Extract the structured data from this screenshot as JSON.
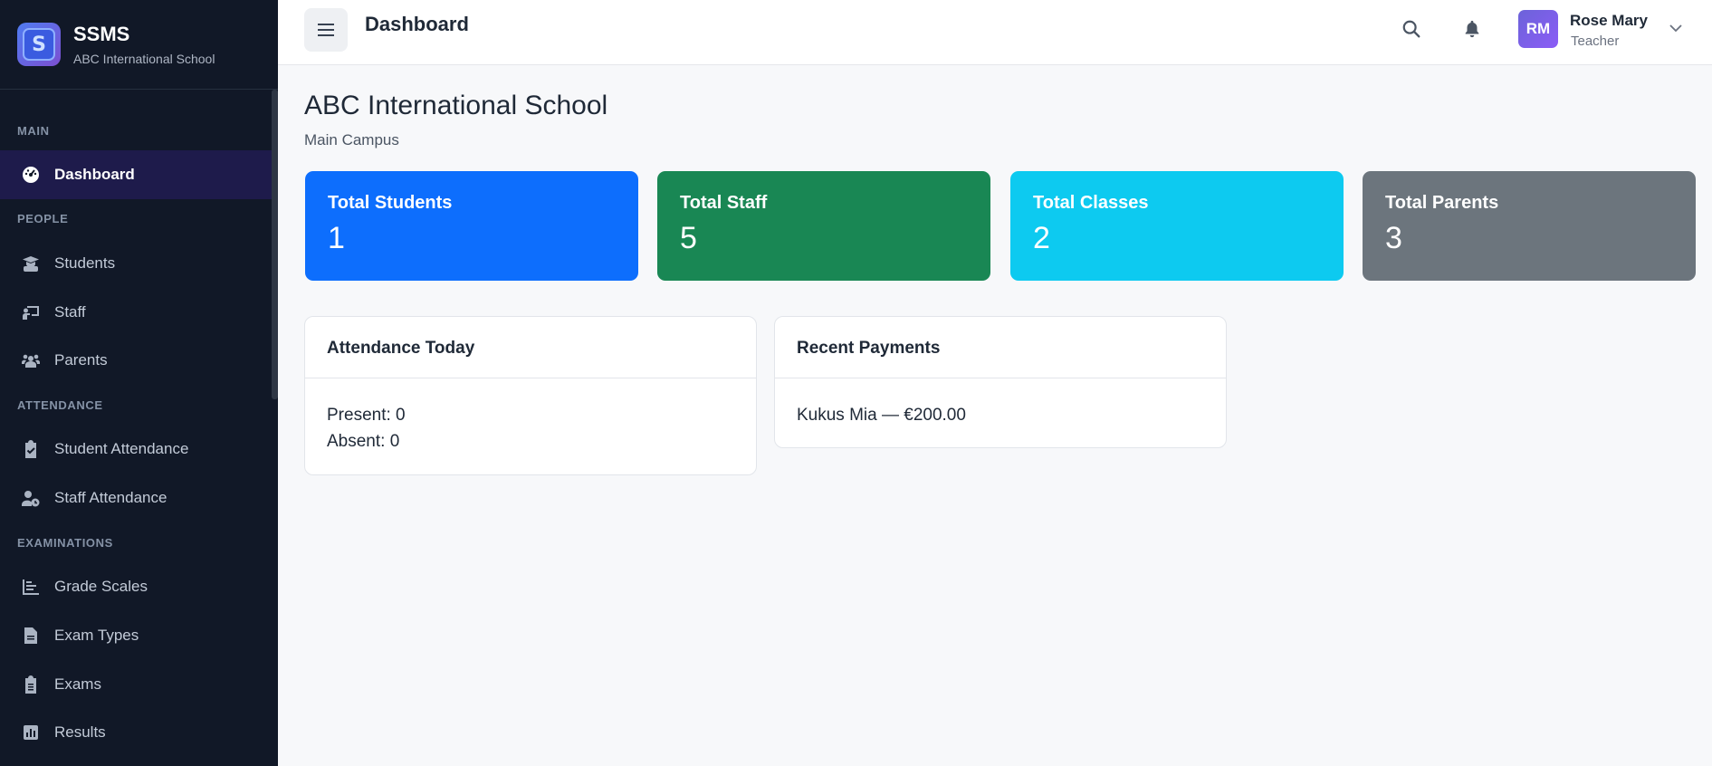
{
  "brand": {
    "name": "SSMS",
    "subtitle": "ABC International School"
  },
  "sidebar": {
    "sections": {
      "main": "MAIN",
      "people": "PEOPLE",
      "attendance": "ATTENDANCE",
      "examinations": "EXAMINATIONS"
    },
    "items": [
      {
        "label": "Dashboard",
        "icon": "dashboard-icon",
        "active": true
      },
      {
        "label": "Students",
        "icon": "graduate-icon"
      },
      {
        "label": "Staff",
        "icon": "chalkboard-teacher-icon"
      },
      {
        "label": "Parents",
        "icon": "users-icon"
      },
      {
        "label": "Student Attendance",
        "icon": "clipboard-check-icon"
      },
      {
        "label": "Staff Attendance",
        "icon": "user-clock-icon"
      },
      {
        "label": "Grade Scales",
        "icon": "chart-bars-icon"
      },
      {
        "label": "Exam Types",
        "icon": "file-icon"
      },
      {
        "label": "Exams",
        "icon": "clipboard-list-icon"
      },
      {
        "label": "Results",
        "icon": "square-chart-icon"
      }
    ]
  },
  "header": {
    "title": "Dashboard",
    "user": {
      "initials": "RM",
      "name": "Rose Mary",
      "role": "Teacher"
    }
  },
  "main": {
    "school_name": "ABC International School",
    "campus": "Main Campus",
    "stats": [
      {
        "label": "Total Students",
        "value": "1",
        "color": "#0d6efd"
      },
      {
        "label": "Total Staff",
        "value": "5",
        "color": "#198754"
      },
      {
        "label": "Total Classes",
        "value": "2",
        "color": "#0dcaf0"
      },
      {
        "label": "Total Parents",
        "value": "3",
        "color": "#6c757d"
      }
    ],
    "attendance": {
      "title": "Attendance Today",
      "present": "Present: 0",
      "absent": "Absent: 0"
    },
    "payments": {
      "title": "Recent Payments",
      "items": [
        "Kukus Mia — €200.00"
      ]
    }
  },
  "colors": {
    "sidebar_bg": "#111827",
    "active_item_bg": "#1e1b4b",
    "page_bg": "#f7f8fa"
  }
}
